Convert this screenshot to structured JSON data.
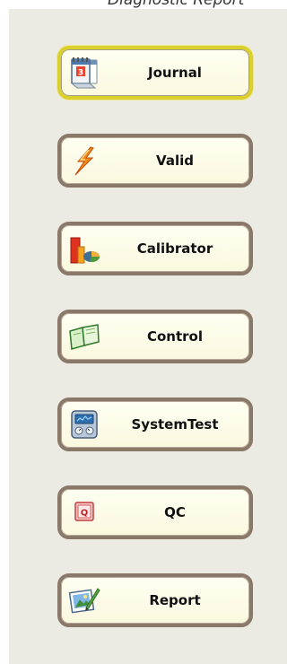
{
  "header": {
    "text": "Diagnostic Report"
  },
  "nav": {
    "buttons": [
      {
        "label": "Journal",
        "icon": "calendar-icon",
        "active": true
      },
      {
        "label": "Valid",
        "icon": "lightning-icon",
        "active": false
      },
      {
        "label": "Calibrator",
        "icon": "chart-icon",
        "active": false
      },
      {
        "label": "Control",
        "icon": "open-book-icon",
        "active": false
      },
      {
        "label": "SystemTest",
        "icon": "control-panel-icon",
        "active": false
      },
      {
        "label": "QC",
        "icon": "qc-icon",
        "active": false
      },
      {
        "label": "Report",
        "icon": "picture-pen-icon",
        "active": false
      }
    ]
  },
  "colors": {
    "panel": "#ecebe3",
    "button_border": "#8a7868",
    "active_border": "#d9d02c",
    "button_fill": "#fdfbe6"
  },
  "calendar_day": "3",
  "qc_badge": "Q"
}
